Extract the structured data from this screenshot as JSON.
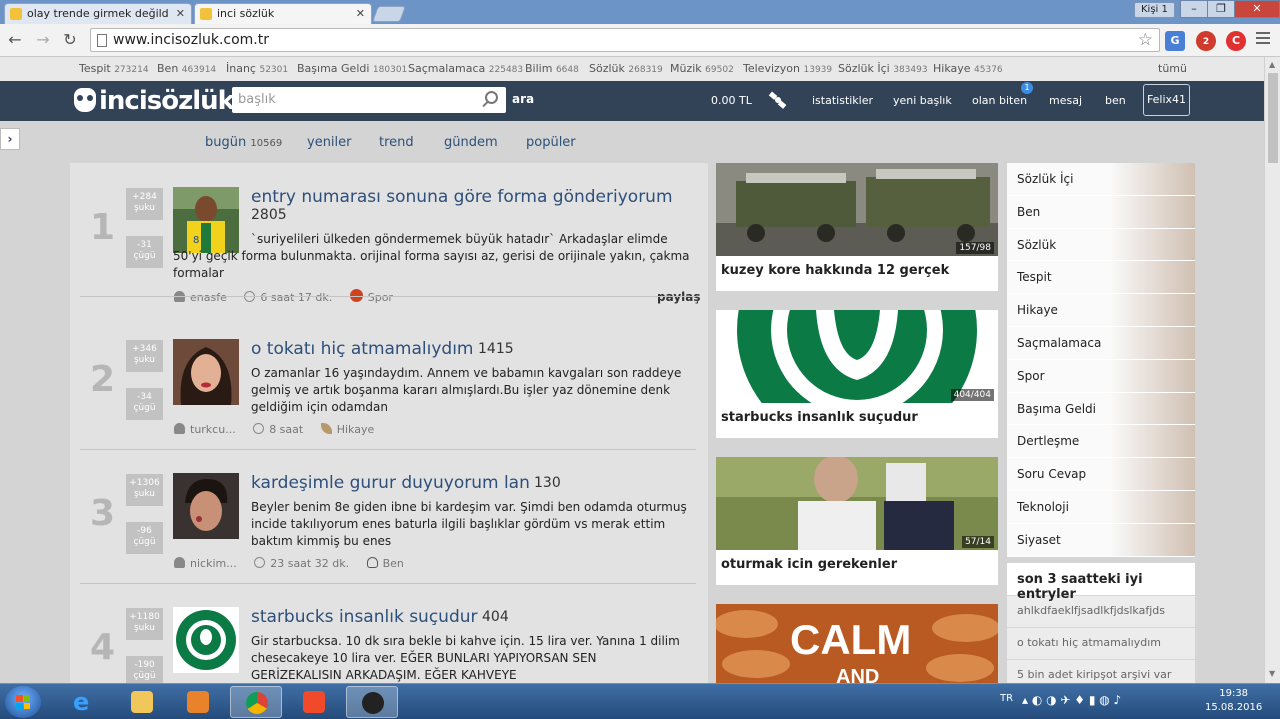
{
  "browser": {
    "tabs": [
      {
        "title": "olay trende girmek değild"
      },
      {
        "title": "inci sözlük"
      }
    ],
    "profile": "Kişi 1",
    "url": "www.incisozluk.com.tr",
    "window_controls": [
      "–",
      "❐",
      "✕"
    ],
    "ext_badge": "2"
  },
  "catbar": [
    {
      "name": "Tespit",
      "count": "273214"
    },
    {
      "name": "Ben",
      "count": "463914"
    },
    {
      "name": "İnanç",
      "count": "52301"
    },
    {
      "name": "Başıma Geldi",
      "count": "180301"
    },
    {
      "name": "Saçmalamaca",
      "count": "225483"
    },
    {
      "name": "Bilim",
      "count": "6648"
    },
    {
      "name": "Sözlük",
      "count": "268319"
    },
    {
      "name": "Müzik",
      "count": "69502"
    },
    {
      "name": "Televizyon",
      "count": "13939"
    },
    {
      "name": "Sözlük İçi",
      "count": "383493"
    },
    {
      "name": "Hikaye",
      "count": "45376"
    }
  ],
  "catbar_all": "tümü",
  "header": {
    "logo": "incisözlük",
    "search_placeholder": "başlık",
    "search_button": "ara",
    "balance": "0.00 TL",
    "nav": [
      "istatistikler",
      "yeni başlık",
      "olan biten",
      "mesaj",
      "ben"
    ],
    "notif_count": "1",
    "user": "Felix41"
  },
  "subnav": {
    "today_label": "bugün",
    "today_count": "10569",
    "items": [
      "yeniler",
      "trend",
      "gündem",
      "popüler"
    ]
  },
  "entries": [
    {
      "rank": "1",
      "up": "+284",
      "up_label": "şuku",
      "down": "-31",
      "down_label": "çügü",
      "title": "entry numarası sonuna göre forma gönderiyorum",
      "count": "2805",
      "body": "`suriyelileri ülkeden göndermemek büyük hatadır` Arkadaşlar elimde 50'yi geçik forma bulunmakta. orijinal forma sayısı az, gerisi de orijinale yakın, çakma formalar",
      "author": "enasfe",
      "time": "6 saat 17 dk.",
      "channel": "Spor",
      "share": "paylaş"
    },
    {
      "rank": "2",
      "up": "+346",
      "up_label": "şuku",
      "down": "-34",
      "down_label": "çügü",
      "title": "o tokatı hiç atmamalıydım",
      "count": "1415",
      "body": "O zamanlar 16 yaşındaydım. Annem ve babamın kavgaları son raddeye gelmiş ve artık boşanma kararı almışlardı.Bu işler yaz dönemine denk geldiğim için odamdan",
      "author": "turkcu...",
      "time": "8 saat",
      "channel": "Hikaye"
    },
    {
      "rank": "3",
      "up": "+1306",
      "up_label": "şuku",
      "down": "-96",
      "down_label": "çügü",
      "title": "kardeşimle gurur duyuyorum lan",
      "count": "130",
      "body": "Beyler benim 8e giden ibne bi kardeşim var. Şimdi ben odamda oturmuş incide takılıyorum enes baturla ilgili başlıklar gördüm vs merak ettim baktım kimmiş bu enes",
      "author": "nickim...",
      "time": "23 saat 32 dk.",
      "channel": "Ben"
    },
    {
      "rank": "4",
      "up": "+1180",
      "up_label": "şuku",
      "down": "-190",
      "down_label": "çügü",
      "title": "starbucks insanlık suçudur",
      "count": "404",
      "body": "Gir starbucksa. 10 dk sıra bekle bi kahve için. 15 lira ver. Yanına 1 dilim chesecakeye 10 lira ver. EĞER BUNLARI YAPIYORSAN SEN GERİZEKALISIN ARKADAŞIM. EĞER KAHVEYE",
      "author": "",
      "time": "",
      "channel": ""
    }
  ],
  "cards": [
    {
      "title": "kuzey kore hakkında 12 gerçek",
      "counter": "157/98"
    },
    {
      "title": "starbucks insanlık suçudur",
      "counter": "404/404"
    },
    {
      "title": "oturmak icin gerekenler",
      "counter": "57/14"
    },
    {
      "title": "",
      "counter": "",
      "overlay_text": "CALM",
      "overlay_text2": "AND"
    }
  ],
  "channels": [
    "Sözlük İçi",
    "Ben",
    "Sözlük",
    "Tespit",
    "Hikaye",
    "Saçmalamaca",
    "Spor",
    "Başıma Geldi",
    "Dertleşme",
    "Soru Cevap",
    "Teknoloji",
    "Siyaset"
  ],
  "good_entries": {
    "title": "son 3 saatteki iyi entryler",
    "items": [
      "ahlkdfaeklfjsadlkfjdslkafjds",
      "o tokatı hiç atmamalıydım",
      "5 bin adet kiripşot arşivi var"
    ]
  },
  "taskbar": {
    "lang": "TR",
    "time": "19:38",
    "date": "15.08.2016"
  },
  "colors": {
    "header": "#324358",
    "link": "#2d4f7a",
    "vote": "#c2c2c2"
  }
}
